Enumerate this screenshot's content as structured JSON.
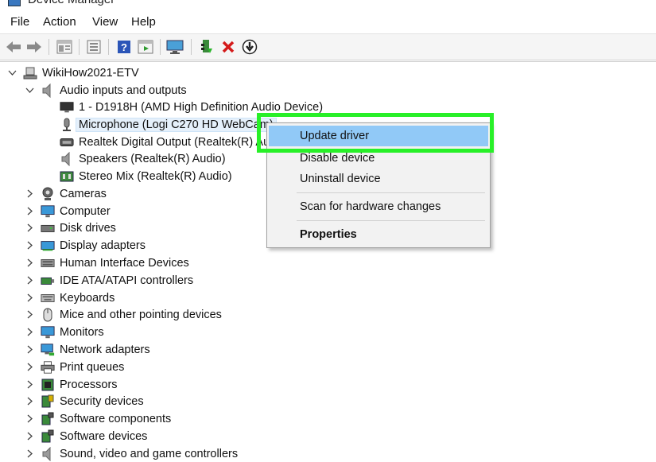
{
  "window": {
    "title": "Device Manager"
  },
  "menu": [
    "File",
    "Action",
    "View",
    "Help"
  ],
  "toolbar": {
    "buttons": [
      "back-arrow-icon",
      "forward-arrow-icon",
      "properties-view-icon",
      "device-list-icon",
      "help-icon",
      "update-view-icon",
      "scan-monitor-icon",
      "enable-driver-icon",
      "uninstall-x-icon",
      "download-driver-icon"
    ]
  },
  "tree": {
    "root": "WikiHow2021-ETV",
    "audio_group": "Audio inputs and outputs",
    "audio_children": [
      "1 - D1918H (AMD High Definition Audio Device)",
      "Microphone (Logi C270 HD WebCam)",
      "Realtek Digital Output (Realtek(R) Audio)",
      "Speakers (Realtek(R) Audio)",
      "Stereo Mix (Realtek(R) Audio)"
    ],
    "categories": [
      "Cameras",
      "Computer",
      "Disk drives",
      "Display adapters",
      "Human Interface Devices",
      "IDE ATA/ATAPI controllers",
      "Keyboards",
      "Mice and other pointing devices",
      "Monitors",
      "Network adapters",
      "Print queues",
      "Processors",
      "Security devices",
      "Software components",
      "Software devices",
      "Sound, video and game controllers"
    ]
  },
  "context_menu": {
    "items": [
      "Update driver",
      "Disable device",
      "Uninstall device",
      "Scan for hardware changes",
      "Properties"
    ]
  },
  "colors": {
    "highlight": "#28f028",
    "menu_active": "#91c9f7"
  }
}
